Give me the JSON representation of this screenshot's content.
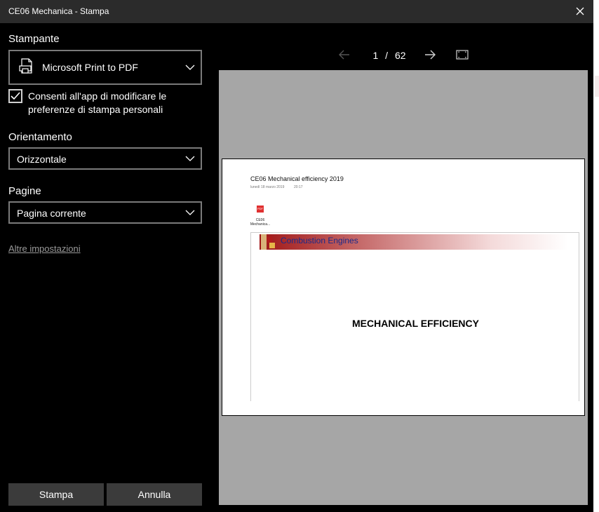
{
  "window": {
    "title": "CE06 Mechanica - Stampa",
    "close_icon": "close-icon"
  },
  "panel": {
    "printer_label": "Stampante",
    "printer_value": "Microsoft Print to PDF",
    "allow_prefs_checked": true,
    "allow_prefs_label": "Consenti all'app di modificare le preferenze di stampa personali",
    "orientation_label": "Orientamento",
    "orientation_value": "Orizzontale",
    "pages_label": "Pagine",
    "pages_value": "Pagina corrente",
    "more_settings": "Altre impostazioni"
  },
  "buttons": {
    "print": "Stampa",
    "cancel": "Annulla"
  },
  "pager": {
    "current": "1",
    "separator": "/",
    "total": "62"
  },
  "preview": {
    "doc_title": "CE06 Mechanical efficiency 2019",
    "doc_date": "lunedì 18 marzo 2019",
    "doc_time": "20:17",
    "attachment_badge": "PDF",
    "attachment_name": "CE06 Mechanica...",
    "banner_text": "Combustion Engines",
    "slide_title": "MECHANICAL EFFICIENCY"
  },
  "colors": {
    "background": "#000000",
    "titlebar": "#2b2b2b",
    "button": "#3b3b3b",
    "preview_bg": "#a6a6a6"
  }
}
